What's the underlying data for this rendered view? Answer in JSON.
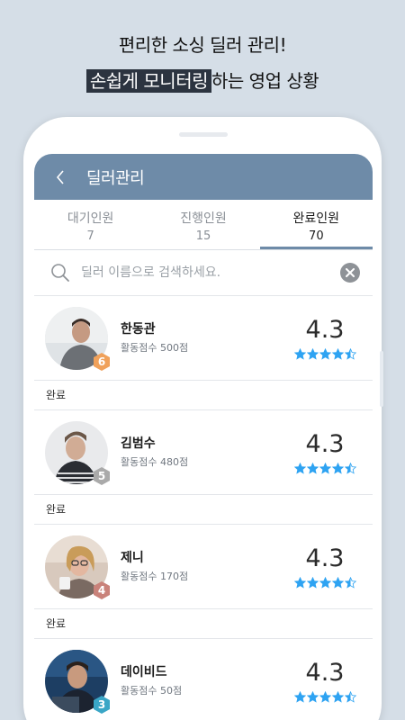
{
  "promo": {
    "line1": "편리한 소싱 딜러 관리!",
    "line2_highlight": "손쉽게 모니터링",
    "line2_rest": "하는 영업 상황"
  },
  "header": {
    "back_icon": "chevron-left-icon",
    "title": "딜러관리"
  },
  "tabs": [
    {
      "label": "대기인원",
      "count": "7"
    },
    {
      "label": "진행인원",
      "count": "15"
    },
    {
      "label": "완료인원",
      "count": "70"
    }
  ],
  "search": {
    "placeholder": "딜러 이름으로 검색하세요.",
    "value": ""
  },
  "colors": {
    "header_bg": "#6e8ba8",
    "star": "#2ea3f2",
    "badge_orange": "#f0a15a",
    "badge_gray": "#aaaaaa",
    "badge_rose": "#c9827a",
    "badge_teal": "#3aa6c6"
  },
  "dealers": [
    {
      "name": "한동관",
      "score": "활동점수 500점",
      "rating": "4.3",
      "stars": 4.5,
      "rank": "6",
      "badge_color": "#f0a15a",
      "status": "완료"
    },
    {
      "name": "김범수",
      "score": "활동점수 480점",
      "rating": "4.3",
      "stars": 4.5,
      "rank": "5",
      "badge_color": "#aaaaaa",
      "status": "완료"
    },
    {
      "name": "제니",
      "score": "활동점수 170점",
      "rating": "4.3",
      "stars": 4.5,
      "rank": "4",
      "badge_color": "#c9827a",
      "status": "완료"
    },
    {
      "name": "데이비드",
      "score": "활동점수 50점",
      "rating": "4.3",
      "stars": 4.5,
      "rank": "3",
      "badge_color": "#3aa6c6",
      "status": ""
    }
  ]
}
